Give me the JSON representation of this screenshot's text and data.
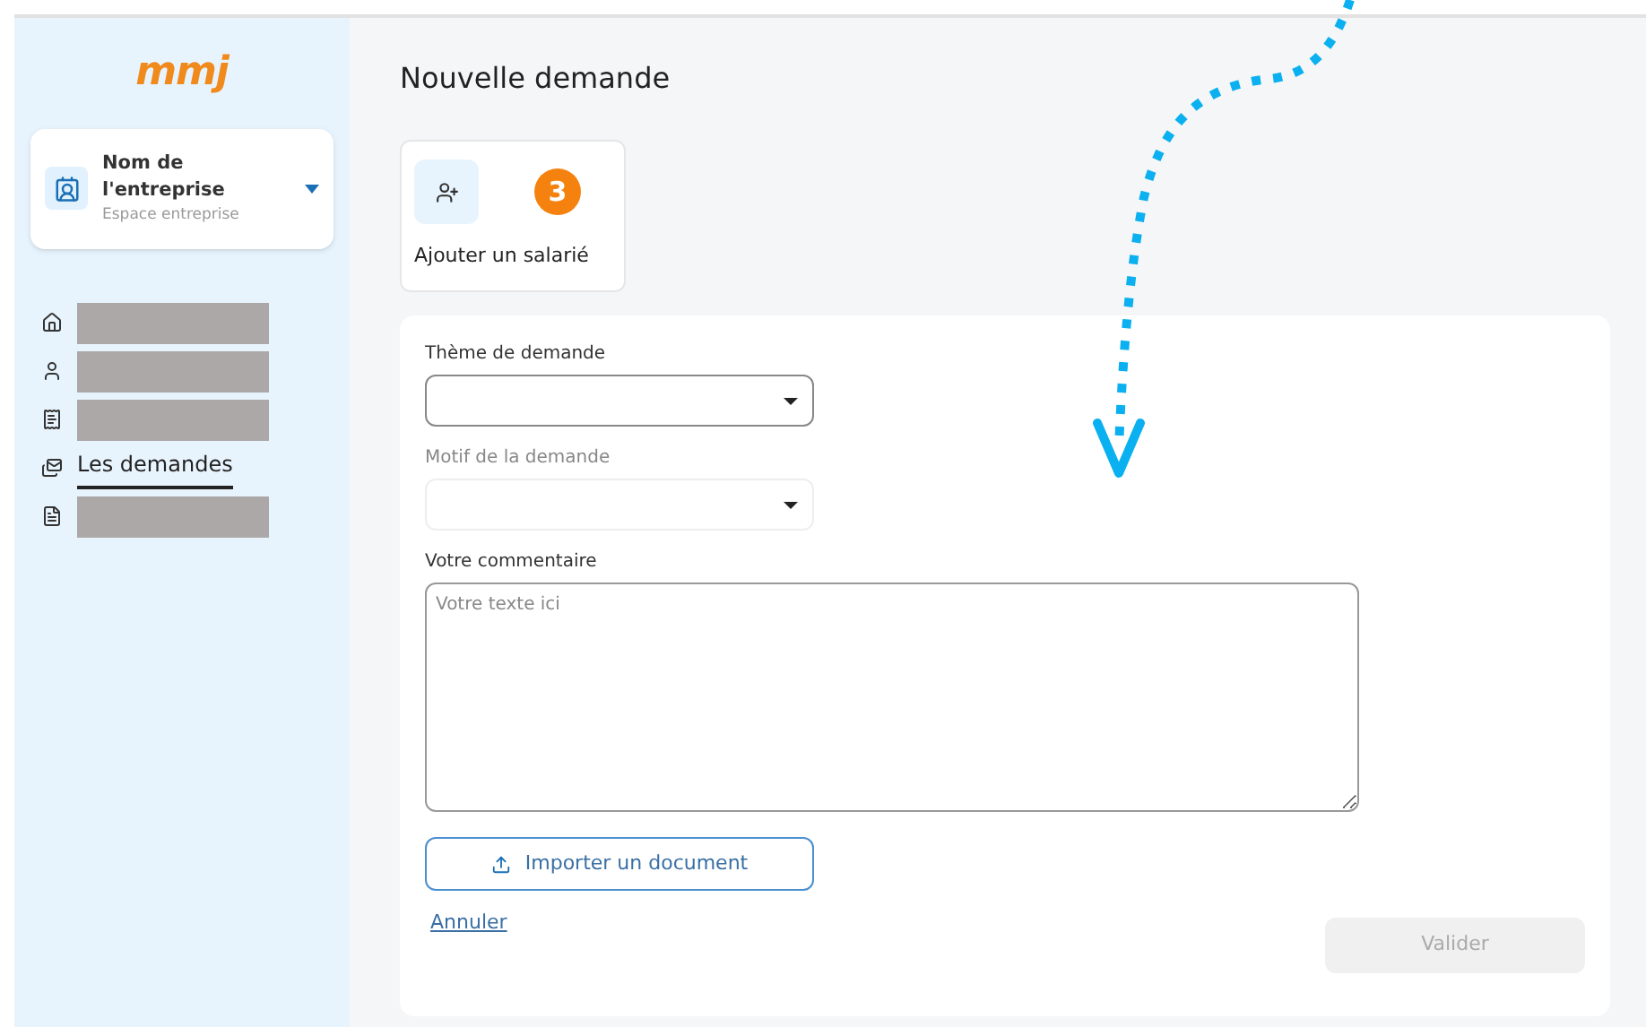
{
  "logo": {
    "text": "mmj"
  },
  "company": {
    "name": "Nom de l'entreprise",
    "subtitle": "Espace entreprise"
  },
  "nav": [
    {
      "kind": "redacted",
      "selected": false
    },
    {
      "kind": "redacted",
      "selected": false
    },
    {
      "kind": "redacted",
      "selected": false
    },
    {
      "kind": "text",
      "label": "Les demandes",
      "selected": true
    },
    {
      "kind": "redacted",
      "selected": false
    }
  ],
  "page_title": "Nouvelle demande",
  "action_card": {
    "label": "Ajouter un salarié",
    "badge": "3"
  },
  "form": {
    "fields": [
      {
        "kind": "select",
        "label": "Thème de demande",
        "disabled": false
      },
      {
        "kind": "select",
        "label": "Motif de la demande",
        "disabled": true
      },
      {
        "kind": "textarea",
        "label": "Votre commentaire",
        "placeholder": "Votre texte ici",
        "disabled": false
      }
    ],
    "upload_button": "Importer un document",
    "cancel_link": "Annuler",
    "submit_button": {
      "label": "Valider",
      "disabled": true
    }
  }
}
